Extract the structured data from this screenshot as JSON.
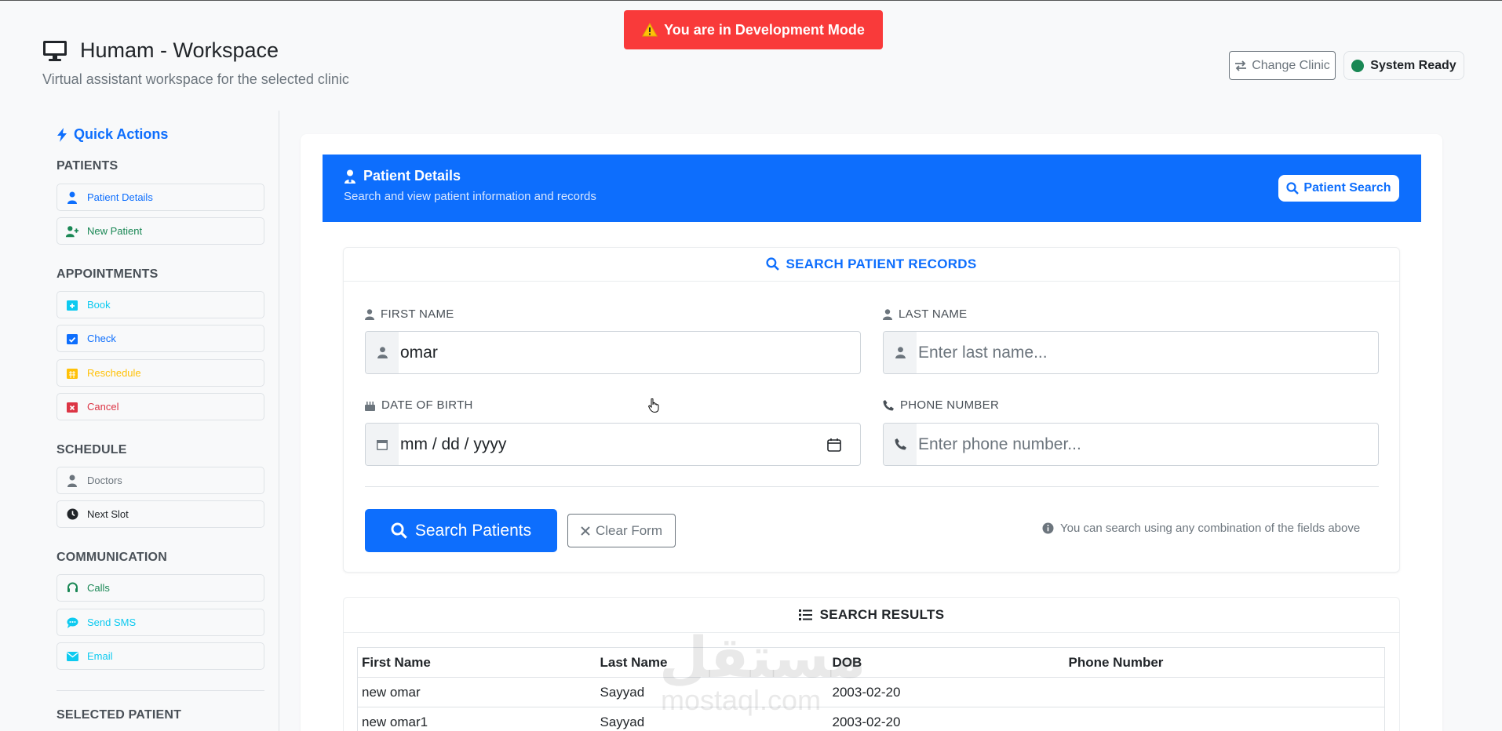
{
  "dev_banner": {
    "icon": "warning-icon",
    "text": "You are in Development Mode",
    "color": "#f93a3a"
  },
  "header": {
    "title": "Humam - Workspace",
    "subtitle": "Virtual assistant workspace for the selected clinic",
    "change_clinic_label": "Change Clinic",
    "status_label": "System Ready",
    "status_color": "#198754"
  },
  "sidebar": {
    "title": "Quick Actions",
    "sections": {
      "patients": "PATIENTS",
      "appointments": "APPOINTMENTS",
      "schedule": "SCHEDULE",
      "communication": "COMMUNICATION",
      "selected_patient": "SELECTED PATIENT"
    },
    "items": {
      "patient_details": "Patient Details",
      "new_patient": "New Patient",
      "book": "Book",
      "check": "Check",
      "reschedule": "Reschedule",
      "cancel": "Cancel",
      "doctors": "Doctors",
      "next_slot": "Next Slot",
      "calls": "Calls",
      "send_sms": "Send SMS",
      "email": "Email"
    }
  },
  "panel": {
    "title": "Patient Details",
    "subtitle": "Search and view patient information and records",
    "patient_search_label": "Patient Search",
    "accent": "#0d6efd"
  },
  "search_form": {
    "heading": "SEARCH PATIENT RECORDS",
    "first_name_label": "FIRST NAME",
    "first_name_value": "omar",
    "last_name_label": "LAST NAME",
    "last_name_placeholder": "Enter last name...",
    "dob_label": "DATE OF BIRTH",
    "dob_placeholder": "mm / dd / yyyy",
    "phone_label": "PHONE NUMBER",
    "phone_placeholder": "Enter phone number...",
    "search_button": "Search Patients",
    "clear_button": "Clear Form",
    "hint": "You can search using any combination of the fields above"
  },
  "results": {
    "heading": "SEARCH RESULTS",
    "columns": [
      "First Name",
      "Last Name",
      "DOB",
      "Phone Number"
    ],
    "rows": [
      [
        "new omar",
        "Sayyad",
        "2003-02-20",
        ""
      ],
      [
        "new omar1",
        "Sayyad",
        "2003-02-20",
        ""
      ]
    ]
  },
  "watermark": {
    "arabic": "مستقل",
    "latin": "mostaql.com"
  }
}
